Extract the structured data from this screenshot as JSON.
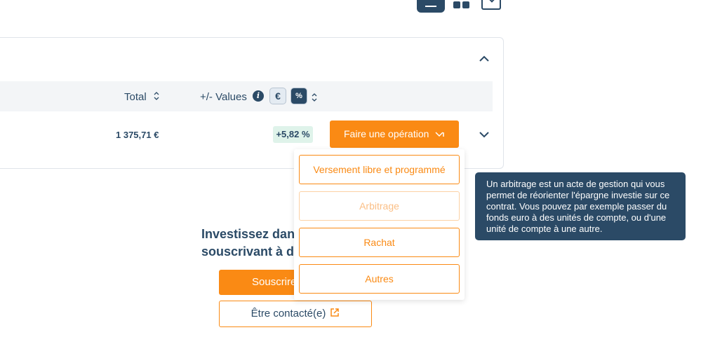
{
  "table": {
    "header_total": "Total",
    "header_values": "+/- Values",
    "info_icon_text": "i",
    "toggle_euro": "€",
    "toggle_percent": "%",
    "row_total": "1 375,71 €",
    "row_percent": "+5,82 %"
  },
  "actions": {
    "operation_button": "Faire une opération"
  },
  "dropdown": {
    "items": [
      {
        "label": "Versement libre et programmé",
        "enabled": true
      },
      {
        "label": "Arbitrage",
        "enabled": false
      },
      {
        "label": "Rachat",
        "enabled": true
      },
      {
        "label": "Autres",
        "enabled": true
      }
    ]
  },
  "tooltip": {
    "text": "Un arbitrage est un acte de gestion qui vous permet de réorienter l'épargne investie sur ce contrat. Vous pouvez par exemple passer du fonds euro à des unités de compte, ou d'une unité de compte à une autre."
  },
  "promo": {
    "title_line1": "Investissez dans",
    "title_line2": "souscrivant à de",
    "subscribe_button": "Souscrire",
    "contact_button": "Être contacté(e)"
  },
  "colors": {
    "accent": "#fa8a14",
    "primary": "#2b4a66",
    "badge_bg": "#dff3ea"
  }
}
